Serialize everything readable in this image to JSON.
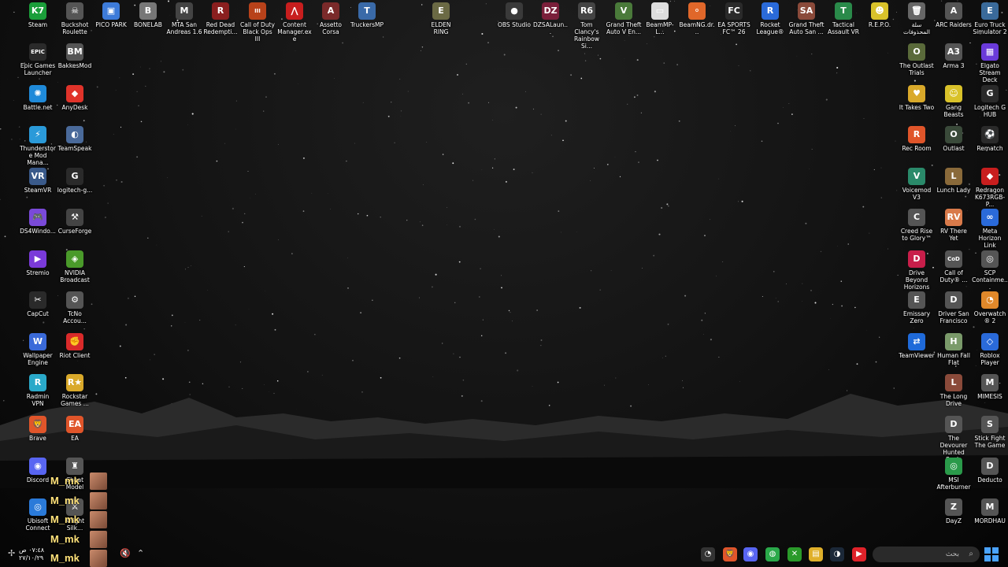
{
  "colors": {
    "background": "#121212",
    "label_text": "#ffffff",
    "overlay_name": "#ffe27a",
    "search_bg": "#2a2a2a",
    "start_accent": "#4aa3ff"
  },
  "desktop": {
    "icons": [
      {
        "label": "Steam",
        "glyph": "K7",
        "color": "#1b9e3a"
      },
      {
        "label": "Buckshot Roulette",
        "glyph": "☠",
        "color": "#555555"
      },
      {
        "label": "PICO PARK",
        "glyph": "▣",
        "color": "#3d7bd9"
      },
      {
        "label": "BONELAB",
        "glyph": "B",
        "color": "#777777"
      },
      {
        "label": "MTA San Andreas 1.6",
        "glyph": "M",
        "color": "#444444"
      },
      {
        "label": "Red Dead Redempti...",
        "glyph": "R",
        "color": "#8a1f1f"
      },
      {
        "label": "Call of Duty Black Ops III",
        "glyph": "III",
        "color": "#b8421a"
      },
      {
        "label": "Content Manager.exe",
        "glyph": "⋀",
        "color": "#c81e1e"
      },
      {
        "label": "Assetto Corsa",
        "glyph": "A",
        "color": "#7a2a2a"
      },
      {
        "label": "TruckersMP",
        "glyph": "T",
        "color": "#3a6aa8"
      },
      {
        "label": "ELDEN RING",
        "glyph": "E",
        "color": "#6b6a44"
      },
      {
        "label": "OBS Studio",
        "glyph": "●",
        "color": "#3a3a3a"
      },
      {
        "label": "DZSALaun...",
        "glyph": "DZ",
        "color": "#7a1f3a"
      },
      {
        "label": "Tom Clancy's Rainbow Si...",
        "glyph": "R6",
        "color": "#444444"
      },
      {
        "label": "Grand Theft Auto V En...",
        "glyph": "V",
        "color": "#4a7a3a"
      },
      {
        "label": "BeamMP-L...",
        "glyph": "▭",
        "color": "#dddddd"
      },
      {
        "label": "BeamNG.dr...",
        "glyph": "⚬",
        "color": "#e0672a"
      },
      {
        "label": "EA SPORTS FC™ 26",
        "glyph": "FC",
        "color": "#2a2a2a"
      },
      {
        "label": "Rocket League®",
        "glyph": "R",
        "color": "#2a6ad9"
      },
      {
        "label": "Grand Theft Auto San ...",
        "glyph": "SA",
        "color": "#8a4a3a"
      },
      {
        "label": "Tactical Assault VR",
        "glyph": "T",
        "color": "#2a8a4a"
      },
      {
        "label": "R.E.P.O.",
        "glyph": "☻",
        "color": "#d9c22a"
      },
      {
        "label": "سلة المحذوفات",
        "glyph": "🗑",
        "color": "#666666"
      },
      {
        "label": "ARC Raiders",
        "glyph": "A",
        "color": "#555555"
      },
      {
        "label": "Euro Truck Simulator 2",
        "glyph": "E",
        "color": "#3a6a9a"
      },
      {
        "label": "Epic Games Launcher",
        "glyph": "EPIC",
        "color": "#2a2a2a"
      },
      {
        "label": "BakkesMod",
        "glyph": "BM",
        "color": "#555555"
      },
      {
        "label": "Battle.net",
        "glyph": "✺",
        "color": "#1f8ad9"
      },
      {
        "label": "AnyDesk",
        "glyph": "◆",
        "color": "#e0332a"
      },
      {
        "label": "Thunderstore Mod Mana...",
        "glyph": "⚡",
        "color": "#2a9ad9"
      },
      {
        "label": "TeamSpeak",
        "glyph": "◐",
        "color": "#4a6a9a"
      },
      {
        "label": "SteamVR",
        "glyph": "VR",
        "color": "#3a5a8a"
      },
      {
        "label": "logitech-g...",
        "glyph": "G",
        "color": "#2a2a2a"
      },
      {
        "label": "DS4Windo...",
        "glyph": "🎮",
        "color": "#7a4ad9"
      },
      {
        "label": "CurseForge",
        "glyph": "⚒",
        "color": "#444444"
      },
      {
        "label": "Stremio",
        "glyph": "▶",
        "color": "#7a3ad9"
      },
      {
        "label": "NVIDIA Broadcast",
        "glyph": "◈",
        "color": "#4a9a2a"
      },
      {
        "label": "CapCut",
        "glyph": "✂",
        "color": "#2a2a2a"
      },
      {
        "label": "TcNo Accou...",
        "glyph": "⚙",
        "color": "#555555"
      },
      {
        "label": "Wallpaper Engine",
        "glyph": "W",
        "color": "#3a6ad9"
      },
      {
        "label": "Riot Client",
        "glyph": "✊",
        "color": "#d92a2a"
      },
      {
        "label": "Radmin VPN",
        "glyph": "R",
        "color": "#2aa9c9"
      },
      {
        "label": "Rockstar Games ...",
        "glyph": "R★",
        "color": "#d9a92a"
      },
      {
        "label": "Brave",
        "glyph": "🦁",
        "color": "#e0552a"
      },
      {
        "label": "EA",
        "glyph": "EA",
        "color": "#e0552a"
      },
      {
        "label": "Discord",
        "glyph": "◉",
        "color": "#5865f2"
      },
      {
        "label": "Cheat Model",
        "glyph": "♜",
        "color": "#555555"
      },
      {
        "label": "Ubisoft Connect",
        "glyph": "◎",
        "color": "#2a7ad9"
      },
      {
        "label": "Knight Silk...",
        "glyph": "⚔",
        "color": "#555555"
      },
      {
        "label": "The Outlast Trials",
        "glyph": "O",
        "color": "#5a6a3a"
      },
      {
        "label": "Arma 3",
        "glyph": "A3",
        "color": "#555555"
      },
      {
        "label": "Elgato Stream Deck",
        "glyph": "▦",
        "color": "#6a3ad9"
      },
      {
        "label": "It Takes Two",
        "glyph": "♥",
        "color": "#d9a92a"
      },
      {
        "label": "Gang Beasts",
        "glyph": "☺",
        "color": "#d9c22a"
      },
      {
        "label": "Logitech G HUB",
        "glyph": "G",
        "color": "#2a2a2a"
      },
      {
        "label": "Rec Room",
        "glyph": "R",
        "color": "#e0552a"
      },
      {
        "label": "Outlast",
        "glyph": "O",
        "color": "#3a4a3a"
      },
      {
        "label": "Rematch",
        "glyph": "⚽",
        "color": "#2a2a2a"
      },
      {
        "label": "Voicemod V3",
        "glyph": "V",
        "color": "#2a8a6a"
      },
      {
        "label": "Lunch Lady",
        "glyph": "L",
        "color": "#8a6a3a"
      },
      {
        "label": "Redragon K673RGB-P...",
        "glyph": "◆",
        "color": "#c81e1e"
      },
      {
        "label": "Creed Rise to Glory™",
        "glyph": "C",
        "color": "#555555"
      },
      {
        "label": "RV There Yet",
        "glyph": "RV",
        "color": "#d97a4a"
      },
      {
        "label": "Meta Horizon Link",
        "glyph": "∞",
        "color": "#2a6ad9"
      },
      {
        "label": "Drive Beyond Horizons",
        "glyph": "D",
        "color": "#c81e4a"
      },
      {
        "label": "Call of Duty® ...",
        "glyph": "CoD",
        "color": "#555555"
      },
      {
        "label": "SCP Containme...",
        "glyph": "◎",
        "color": "#555555"
      },
      {
        "label": "Emissary Zero",
        "glyph": "E",
        "color": "#555555"
      },
      {
        "label": "Driver San Francisco",
        "glyph": "D",
        "color": "#555555"
      },
      {
        "label": "Overwatch® 2",
        "glyph": "◔",
        "color": "#e0882a"
      },
      {
        "label": "TeamViewer",
        "glyph": "⇄",
        "color": "#1f6ad9"
      },
      {
        "label": "Human Fall Flat",
        "glyph": "H",
        "color": "#7a9a6a"
      },
      {
        "label": "Roblox Player",
        "glyph": "◇",
        "color": "#2a6ad9"
      },
      {
        "label": "The Long Drive",
        "glyph": "L",
        "color": "#8a4a3a"
      },
      {
        "label": "MIMESIS",
        "glyph": "M",
        "color": "#555555"
      },
      {
        "label": "The Devourer Hunted Souls",
        "glyph": "D",
        "color": "#555555"
      },
      {
        "label": "Stick Fight The Game",
        "glyph": "S",
        "color": "#555555"
      },
      {
        "label": "MSI Afterburner",
        "glyph": "◎",
        "color": "#2a9a4a"
      },
      {
        "label": "Deducto",
        "glyph": "D",
        "color": "#555555"
      },
      {
        "label": "DayZ",
        "glyph": "Z",
        "color": "#555555"
      },
      {
        "label": "MORDHAU",
        "glyph": "M",
        "color": "#555555"
      }
    ]
  },
  "overlay": {
    "users": [
      {
        "name": "M_mk"
      },
      {
        "name": "M_mk"
      },
      {
        "name": "M_mk"
      },
      {
        "name": "M_mk"
      },
      {
        "name": "M_mk"
      }
    ]
  },
  "taskbar": {
    "clock_time": "٠٧:٤٨ ص",
    "clock_date": "٢٧/١٠/٢٩",
    "search_placeholder": "بحث",
    "apps": [
      {
        "name": "overlay-app",
        "glyph": "◔",
        "color": "#333333"
      },
      {
        "name": "brave",
        "glyph": "🦁",
        "color": "#e0552a"
      },
      {
        "name": "discord",
        "glyph": "◉",
        "color": "#5865f2"
      },
      {
        "name": "chrome",
        "glyph": "◍",
        "color": "#2aa94a"
      },
      {
        "name": "xbox",
        "glyph": "✕",
        "color": "#2a9a2a"
      },
      {
        "name": "file-explorer",
        "glyph": "▤",
        "color": "#e0b02a"
      },
      {
        "name": "steam",
        "glyph": "◑",
        "color": "#1b2838"
      },
      {
        "name": "youtube",
        "glyph": "▶",
        "color": "#e0222a"
      }
    ]
  }
}
